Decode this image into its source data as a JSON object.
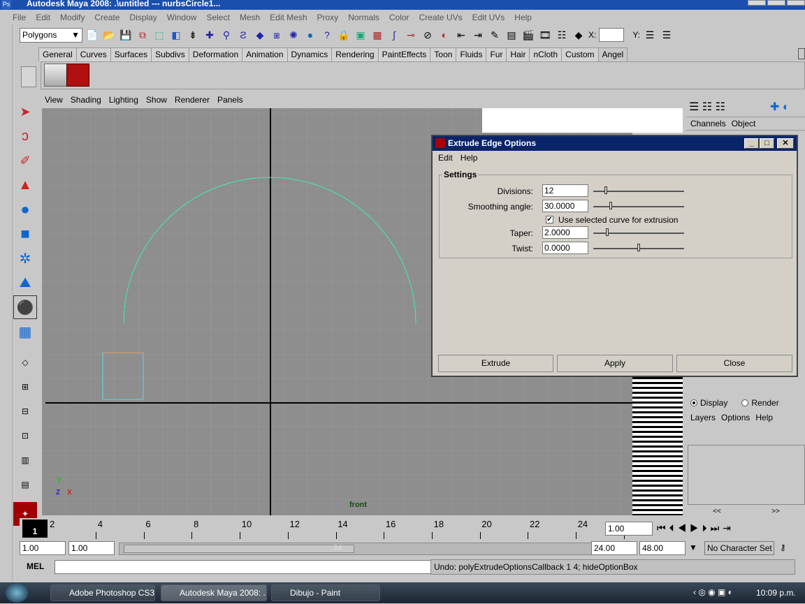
{
  "window": {
    "title": "Autodesk Maya 2008: .\\untitled   ---   nurbsCircle1...",
    "ps_badge": "Ps"
  },
  "menubar": [
    "File",
    "Edit",
    "Modify",
    "Create",
    "Display",
    "Window",
    "Select",
    "Mesh",
    "Edit Mesh",
    "Proxy",
    "Normals",
    "Color",
    "Create UVs",
    "Edit UVs",
    "Help"
  ],
  "toolbar": {
    "mode": "Polygons",
    "y_label": "Y:",
    "x_label": "X:"
  },
  "shelf_tabs": [
    "General",
    "Curves",
    "Surfaces",
    "Subdivs",
    "Deformation",
    "Animation",
    "Dynamics",
    "Rendering",
    "PaintEffects",
    "Toon",
    "Fluids",
    "Fur",
    "Hair",
    "nCloth",
    "Custom",
    "Angel"
  ],
  "panel_menu": [
    "View",
    "Shading",
    "Lighting",
    "Show",
    "Renderer",
    "Panels"
  ],
  "viewport": {
    "camera_label": "front",
    "axis_y": "Y",
    "axis_z": "Z",
    "axis_x": "X"
  },
  "channel_box": {
    "channels": "Channels",
    "object": "Object"
  },
  "layer_editor": {
    "display": "Display",
    "render": "Render",
    "menu": [
      "Layers",
      "Options",
      "Help"
    ],
    "prev": "<<",
    "next": ">>"
  },
  "dialog": {
    "title": "Extrude Edge Options",
    "menu": [
      "Edit",
      "Help"
    ],
    "section": "Settings",
    "divisions_label": "Divisions:",
    "divisions": "12",
    "smoothing_label": "Smoothing angle:",
    "smoothing": "30.0000",
    "use_curve_label": "Use selected curve for extrusion",
    "use_curve_checked": "✔",
    "taper_label": "Taper:",
    "taper": "2.0000",
    "twist_label": "Twist:",
    "twist": "0.0000",
    "extrude": "Extrude",
    "apply": "Apply",
    "close": "Close"
  },
  "timeline": {
    "ticks": [
      "2",
      "4",
      "6",
      "8",
      "10",
      "12",
      "14",
      "16",
      "18",
      "20",
      "22",
      "24"
    ],
    "current": "1",
    "current_field": "1.00"
  },
  "range": {
    "start": "1.00",
    "start2": "1.00",
    "end_anim": "24.00",
    "end": "48.00",
    "char_set": "No Character Set",
    "slider_end": "24"
  },
  "cmdline": {
    "label": "MEL",
    "result": "Undo: polyExtrudeOptionsCallback 1 4; hideOptionBox"
  },
  "taskbar": {
    "items": [
      "Adobe Photoshop CS3...",
      "Autodesk Maya 2008: ...",
      "Dibujo - Paint"
    ],
    "clock": "10:09 p.m."
  }
}
